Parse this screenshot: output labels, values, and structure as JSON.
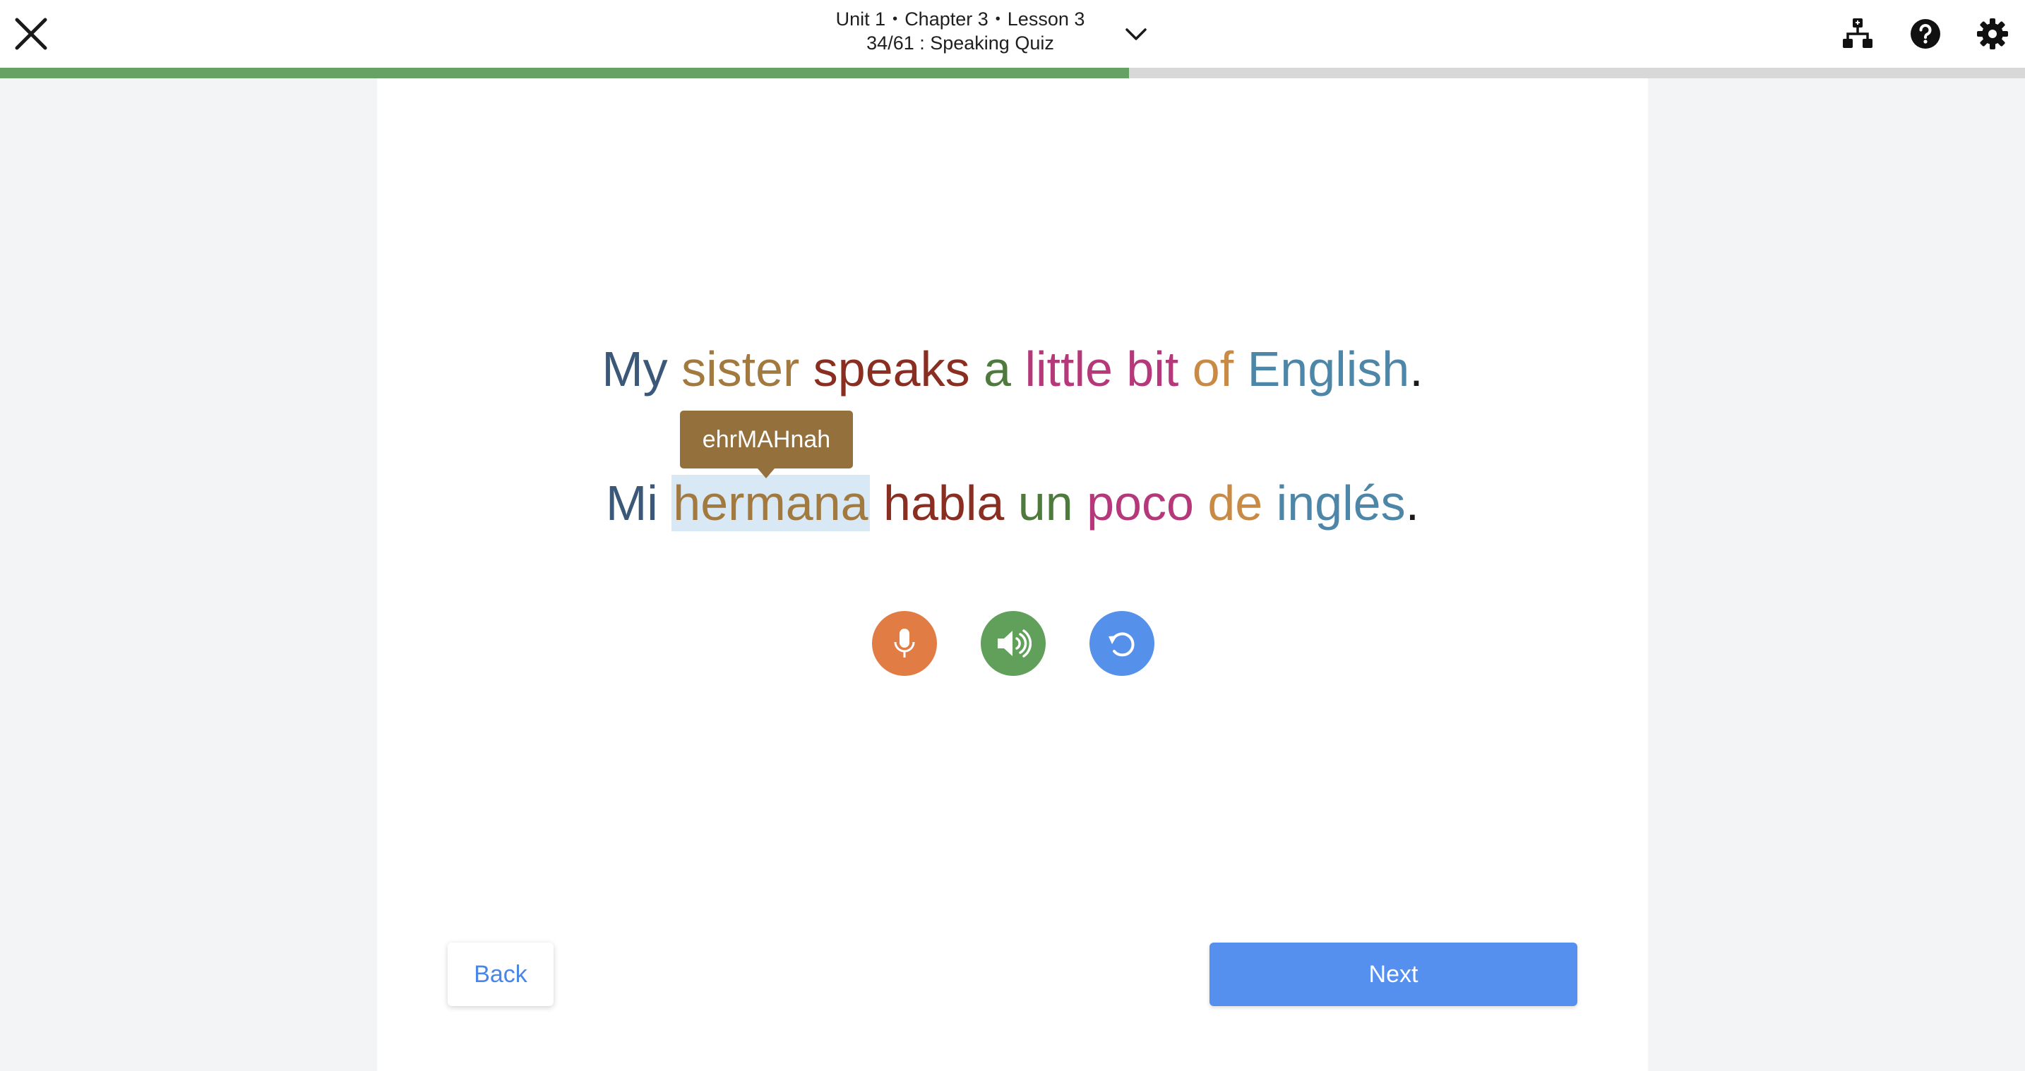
{
  "header": {
    "unit": "Unit 1",
    "chapter": "Chapter 3",
    "lesson": "Lesson 3",
    "separator": "•",
    "progress_title": "34/61 : Speaking Quiz",
    "dropdown_icon": "chevron-down-icon",
    "close_icon": "close-icon",
    "icons": [
      "sitemap-icon",
      "help-icon",
      "gear-icon"
    ]
  },
  "progress": {
    "current": 34,
    "total": 61,
    "fill_color": "#66a263"
  },
  "english_sentence": {
    "words": [
      {
        "text": "My",
        "color": "#3b5878"
      },
      {
        "text": "sister",
        "color": "#a27a3f"
      },
      {
        "text": "speaks",
        "color": "#8b2e22"
      },
      {
        "text": "a",
        "color": "#4f7a3d"
      },
      {
        "text": "little",
        "color": "#b5397a"
      },
      {
        "text": "bit",
        "color": "#b5397a"
      },
      {
        "text": "of",
        "color": "#c98a45"
      },
      {
        "text": "English",
        "color": "#4e86a8"
      }
    ],
    "punctuation": "."
  },
  "spanish_sentence": {
    "words": [
      {
        "text": "Mi",
        "color": "#3b5878"
      },
      {
        "text": "hermana",
        "color": "#a27a3f"
      },
      {
        "text": "habla",
        "color": "#8b2e22"
      },
      {
        "text": "un",
        "color": "#4f7a3d"
      },
      {
        "text": "poco",
        "color": "#b5397a"
      },
      {
        "text": "de",
        "color": "#c98a45"
      },
      {
        "text": "inglés",
        "color": "#4e86a8"
      }
    ],
    "punctuation": ".",
    "highlighted_word": "hermana"
  },
  "tooltip": {
    "text": "ehrMAHnah",
    "color": "#94703c"
  },
  "controls": [
    {
      "name": "microphone-icon",
      "color": "#e17c45"
    },
    {
      "name": "speaker-icon",
      "color": "#60a05b"
    },
    {
      "name": "replay-icon",
      "color": "#5590eb"
    }
  ],
  "navigation": {
    "back_label": "Back",
    "next_label": "Next"
  }
}
